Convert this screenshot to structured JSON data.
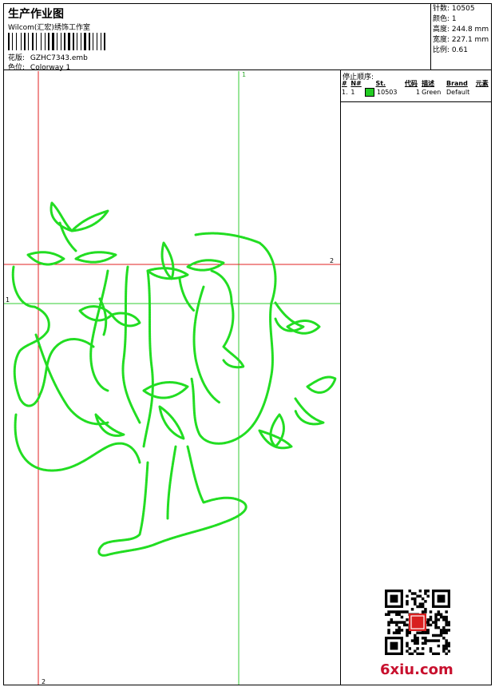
{
  "header": {
    "title": "生产作业图",
    "company": "Wilcom(汇宏)绣饰工作室",
    "design_label": "花版:",
    "design_value": "GZHC7343.emb",
    "colorway_label": "色位:",
    "colorway_value": "Colorway 1"
  },
  "stats": [
    {
      "label": "针数:",
      "value": "10505"
    },
    {
      "label": "颜色:",
      "value": "1"
    },
    {
      "label": "高度:",
      "value": "244.8 mm"
    },
    {
      "label": "宽度:",
      "value": "227.1 mm"
    },
    {
      "label": "比例:",
      "value": "0.61"
    }
  ],
  "stop_sequence": {
    "title": "停止顺序:",
    "columns": [
      "#",
      "N#",
      "St.",
      "代码",
      "描述",
      "Brand",
      "元素"
    ],
    "rows": [
      {
        "num": "1.",
        "n": "1",
        "color": "#22cc22",
        "st": "10503",
        "code": "1",
        "desc": "Green",
        "brand": "Default",
        "elem": ""
      }
    ]
  },
  "guides": {
    "v1_label": "1",
    "v2_label": "2",
    "h1_label": "1",
    "h2_label": "2"
  },
  "watermark": "6xiu.com",
  "colors": {
    "stitch": "#22dd22",
    "guide_red": "#e02020",
    "guide_green": "#33cc33"
  }
}
